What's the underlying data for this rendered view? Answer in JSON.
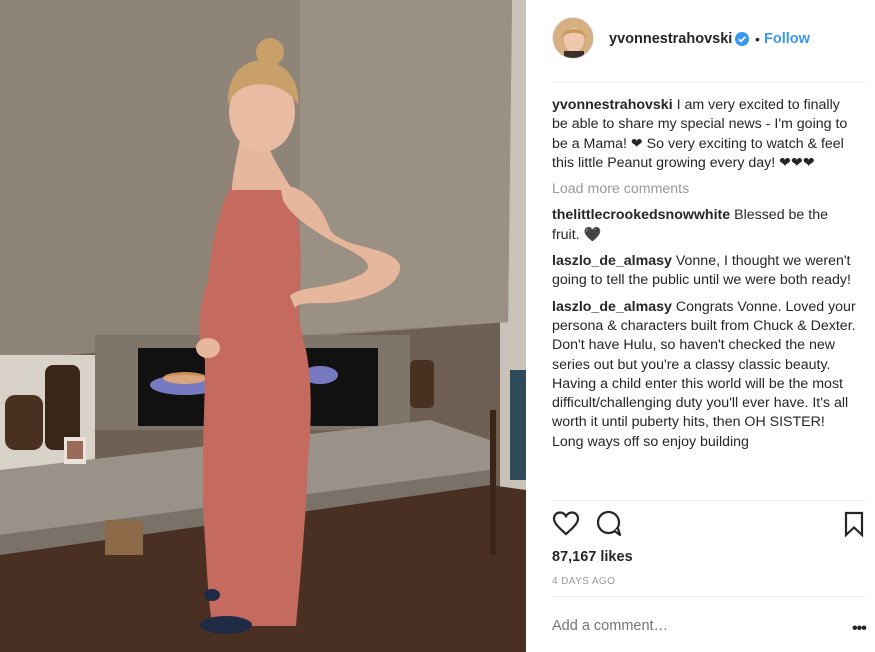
{
  "post": {
    "photo_alt": "pregnant woman in red dress standing by fireplace"
  },
  "header": {
    "username": "yvonnestrahovski",
    "dot": "•",
    "follow_label": "Follow"
  },
  "caption": {
    "username": "yvonnestrahovski",
    "text": "I am very excited to finally be able to share my special news - I'm going to be a Mama! ❤ So very exciting to watch & feel this little Peanut growing every day! ❤❤❤"
  },
  "load_more_label": "Load more comments",
  "comments": [
    {
      "username": "thelittlecrookedsnowwhite",
      "text": "Blessed be the fruit. 🖤"
    },
    {
      "username": "laszlo_de_almasy",
      "text": "Vonne, I thought we weren't going to tell the public until we were both ready!"
    },
    {
      "username": "laszlo_de_almasy",
      "text": "Congrats Vonne. Loved your persona & characters built from Chuck & Dexter. Don't have Hulu, so haven't checked the new series out but you're a classy classic beauty. Having a child enter this world will be the most difficult/challenging duty you'll ever have. It's all worth it until puberty hits, then OH SISTER! Long ways off so enjoy building"
    }
  ],
  "likes_label": "87,167 likes",
  "age_label": "4 DAYS AGO",
  "add_comment_placeholder": "Add a comment…",
  "more_label": "•••",
  "icons": {
    "like": "heart-icon",
    "comment": "comment-bubble-icon",
    "save": "bookmark-icon",
    "verified": "verified-badge-icon"
  },
  "colors": {
    "follow": "#3897f0",
    "verified": "#3897f0",
    "muted": "#999999",
    "text": "#262626"
  }
}
